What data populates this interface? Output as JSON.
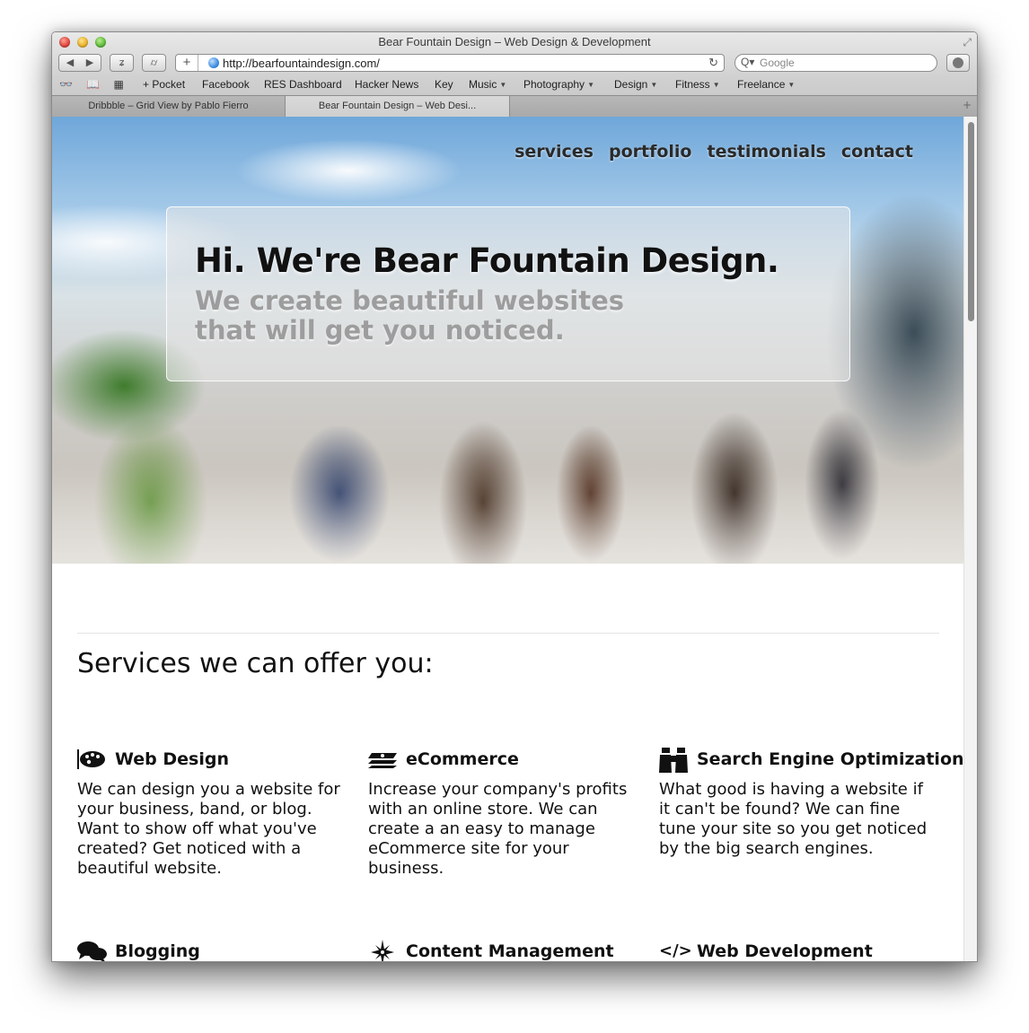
{
  "window": {
    "title": "Bear Fountain Design – Web Design & Development"
  },
  "toolbar": {
    "back_label": "◀",
    "forward_label": "▶",
    "reader_label": "ʑ",
    "topsites_label": "⌭",
    "address_add_label": "+",
    "url": "http://bearfountaindesign.com/",
    "reload_label": "↻",
    "search_placeholder": "Google",
    "search_icon_label": "Q▾"
  },
  "bookmarks": {
    "icons": "👓 📖 ▦",
    "items": [
      {
        "label": "+ Pocket"
      },
      {
        "label": "Facebook"
      },
      {
        "label": "RES Dashboard"
      },
      {
        "label": "Hacker News"
      },
      {
        "label": "Key"
      },
      {
        "label": "Music",
        "has_menu": true
      },
      {
        "label": "Photography",
        "has_menu": true
      },
      {
        "label": "Design",
        "has_menu": true
      },
      {
        "label": "Fitness",
        "has_menu": true
      },
      {
        "label": "Freelance",
        "has_menu": true
      }
    ],
    "menu_arrow": "▼"
  },
  "tabs": [
    {
      "label": "Dribbble – Grid View by Pablo Fierro",
      "active": false
    },
    {
      "label": "Bear Fountain Design – Web Desi...",
      "active": true
    }
  ],
  "tab_add_label": "+",
  "site": {
    "nav": [
      {
        "label": "services"
      },
      {
        "label": "portfolio"
      },
      {
        "label": "testimonials"
      },
      {
        "label": "contact"
      }
    ],
    "hero_title": "Hi. We're Bear Fountain Design.",
    "hero_sub_line1": "We create beautiful websites",
    "hero_sub_line2": "that will get you noticed.",
    "services_heading": "Services we can offer you:",
    "services": [
      {
        "icon": "palette-icon",
        "title": "Web Design",
        "desc": "We can design you a website for your business, band, or blog. Want to show off what you've created? Get noticed with a beautiful website."
      },
      {
        "icon": "money-icon",
        "title": "eCommerce",
        "desc": "Increase your company's profits with an online store. We can create a an easy to manage eCommerce site for your business."
      },
      {
        "icon": "binoculars-icon",
        "title": "Search Engine Optimization",
        "desc": "What good is having a website if it can't be found? We can fine tune your site so you get noticed by the big search engines."
      },
      {
        "icon": "chat-bubbles-icon",
        "title": "Blogging",
        "desc": ""
      },
      {
        "icon": "compass-star-icon",
        "title": "Content Management",
        "desc": ""
      },
      {
        "icon": "code-icon",
        "title": "Web Development",
        "desc": ""
      }
    ],
    "code_icon_text": "</>"
  }
}
